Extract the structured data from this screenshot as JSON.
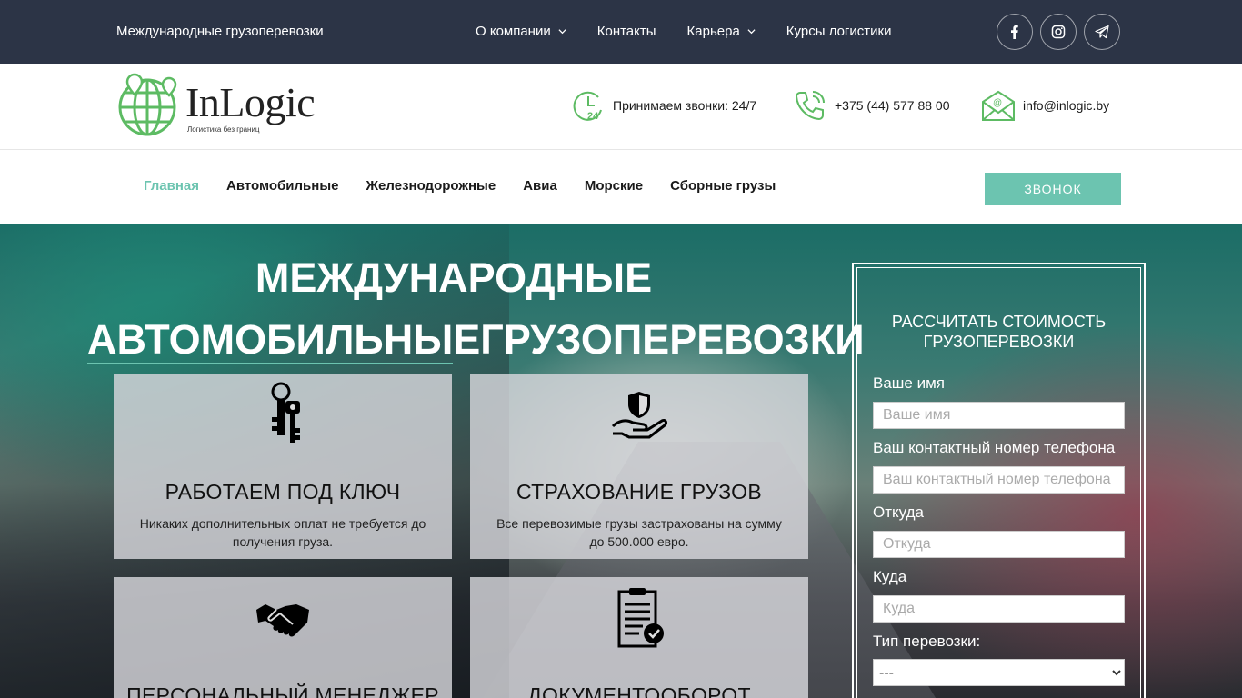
{
  "topbar": {
    "brand_text": "Международные грузоперевозки",
    "nav": [
      {
        "label": "О компании",
        "has_dropdown": true
      },
      {
        "label": "Контакты",
        "has_dropdown": false
      },
      {
        "label": "Карьера",
        "has_dropdown": true
      },
      {
        "label": "Курсы логистики",
        "has_dropdown": false
      }
    ],
    "socials": [
      "facebook-icon",
      "instagram-icon",
      "telegram-icon"
    ],
    "bg_color": "#2c3446"
  },
  "header": {
    "logo_name": "InLogic",
    "logo_tagline": "Логистика без границ",
    "contacts": [
      {
        "icon": "clock-24-icon",
        "text": "Принимаем звонки: 24/7"
      },
      {
        "icon": "phone-icon",
        "text": "+375 (44) 577 88 00"
      },
      {
        "icon": "email-icon",
        "text": "info@inlogic.by"
      }
    ]
  },
  "mainnav": {
    "links": [
      "Главная",
      "Автомобильные",
      "Железнодорожные",
      "Авиа",
      "Морские",
      "Сборные грузы"
    ],
    "active": "Главная",
    "call_button": "Звонок",
    "accent_color": "#6cc4b0"
  },
  "hero": {
    "title_line1": "МЕЖДУНАРОДНЫЕ",
    "title_line2": "АВТОМОБИЛЬНЫЕГРУЗОПЕРЕВОЗКИ",
    "cards": [
      {
        "icon": "keys-icon",
        "title": "РАБОТАЕМ ПОД КЛЮЧ",
        "text": "Никаких дополнительных оплат не требуется до получения груза."
      },
      {
        "icon": "shield-hand-icon",
        "title": "СТРАХОВАНИЕ ГРУЗОВ",
        "text": "Все перевозимые грузы застрахованы на сумму до 500.000 евро."
      },
      {
        "icon": "handshake-icon",
        "title": "ПЕРСОНАЛЬНЫЙ МЕНЕДЖЕР",
        "text": ""
      },
      {
        "icon": "document-check-icon",
        "title": "ДОКУМЕНТООБОРОТ",
        "text": ""
      }
    ]
  },
  "form": {
    "title": "РАССЧИТАТЬ СТОИМОСТЬ ГРУЗОПЕРЕВОЗКИ",
    "fields": [
      {
        "label": "Ваше имя",
        "placeholder": "Ваше имя",
        "value": ""
      },
      {
        "label": "Ваш контактный номер телефона",
        "placeholder": "Ваш контактный номер телефона",
        "value": ""
      },
      {
        "label": "Откуда",
        "placeholder": "Откуда",
        "value": ""
      },
      {
        "label": "Куда",
        "placeholder": "Куда",
        "value": ""
      }
    ],
    "transport_type_label": "Тип перевозки:",
    "transport_type_selected": "---"
  }
}
